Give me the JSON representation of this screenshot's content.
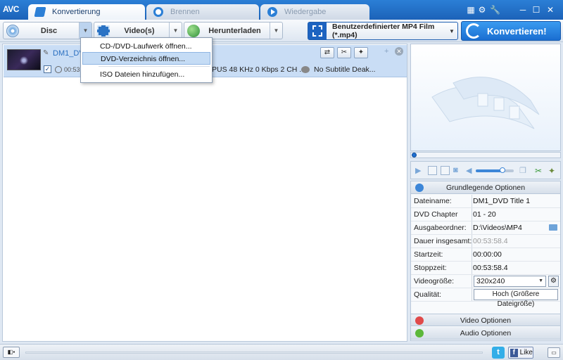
{
  "app": {
    "logo": "AVC",
    "accent_color": "#1f6fd1",
    "tabs": [
      {
        "label": "Konvertierung",
        "icon": "convert-icon",
        "active": true
      },
      {
        "label": "Brennen",
        "icon": "burn-disc-icon",
        "active": false
      },
      {
        "label": "Wiedergabe",
        "icon": "play-icon",
        "active": false
      }
    ],
    "window_controls": [
      "skin-icon",
      "settings-icon",
      "tools-icon",
      "minimize-icon",
      "maximize-icon",
      "close-icon"
    ]
  },
  "toolbar": {
    "disc_label": "Disc",
    "video_label": "Video(s)",
    "download_label": "Herunterladen",
    "output_format": "Benutzerdefinierter MP4 Film (*.mp4)",
    "convert_label": "Konvertieren!"
  },
  "disc_menu": {
    "items": [
      {
        "label": "CD-/DVD-Laufwerk öffnen...",
        "highlighted": false
      },
      {
        "label": "DVD-Verzeichnis öffnen...",
        "highlighted": true
      },
      {
        "label": "ISO Dateien hinzufügen...",
        "highlighted": false
      }
    ]
  },
  "file_list": {
    "items": [
      {
        "title": "DM1_DVD",
        "duration": "00:53:5",
        "checked": true,
        "audio": "PUS 48 KHz 0 Kbps 2 CH ...",
        "subtitle": "No Subtitle Deak..."
      }
    ]
  },
  "options": {
    "header": "Grundlegende Optionen",
    "rows": [
      {
        "key": "Dateiname:",
        "value": "DM1_DVD Title 1"
      },
      {
        "key": "DVD Chapter",
        "value": "01 - 20"
      },
      {
        "key": "Ausgabeordner:",
        "value": "D:\\Videos\\MP4"
      },
      {
        "key": "Dauer insgesamt:",
        "value": "00:53:58.4"
      },
      {
        "key": "Startzeit:",
        "value": "00:00:00"
      },
      {
        "key": "Stoppzeit:",
        "value": "00:53:58.4"
      },
      {
        "key": "Videogröße:",
        "value": "320x240"
      },
      {
        "key": "Qualität:",
        "value": "Hoch (Größere Dateigröße)"
      }
    ],
    "video_options": "Video Optionen",
    "audio_options": "Audio Optionen"
  },
  "preview": {
    "volume_level": 0.7,
    "seek_position": 0
  },
  "statusbar": {
    "twitter": "t",
    "facebook_like": "Like"
  }
}
